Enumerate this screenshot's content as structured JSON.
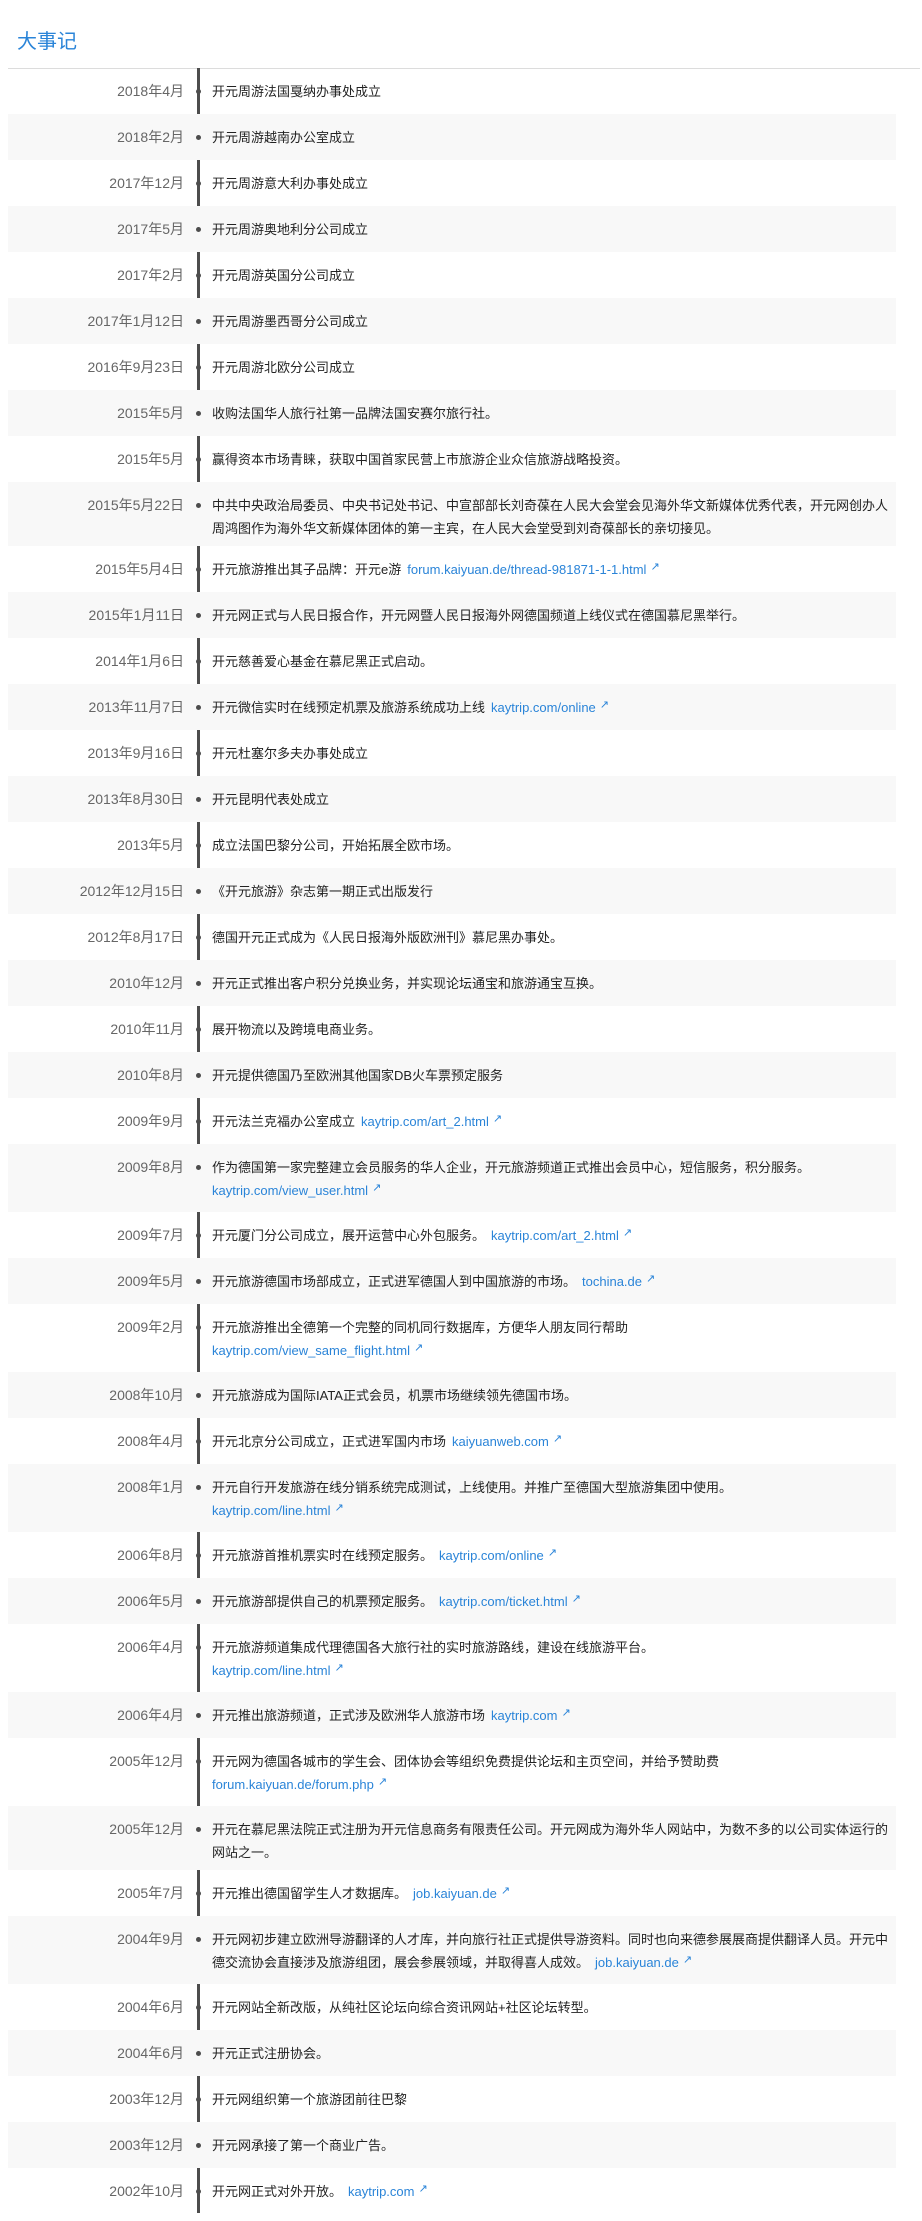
{
  "header": {
    "title": "大事记"
  },
  "events": [
    {
      "date": "2018年4月",
      "text": "开元周游法国戛纳办事处成立"
    },
    {
      "date": "2018年2月",
      "text": "开元周游越南办公室成立"
    },
    {
      "date": "2017年12月",
      "text": "开元周游意大利办事处成立"
    },
    {
      "date": "2017年5月",
      "text": "开元周游奥地利分公司成立"
    },
    {
      "date": "2017年2月",
      "text": "开元周游英国分公司成立"
    },
    {
      "date": "2017年1月12日",
      "text": "开元周游墨西哥分公司成立"
    },
    {
      "date": "2016年9月23日",
      "text": "开元周游北欧分公司成立"
    },
    {
      "date": "2015年5月",
      "text": "收购法国华人旅行社第一品牌法国安赛尔旅行社。"
    },
    {
      "date": "2015年5月",
      "text": "赢得资本市场青睐，获取中国首家民营上市旅游企业众信旅游战略投资。"
    },
    {
      "date": "2015年5月22日",
      "text": "中共中央政治局委员、中央书记处书记、中宣部部长刘奇葆在人民大会堂会见海外华文新媒体优秀代表，开元网创办人周鸿图作为海外华文新媒体团体的第一主宾，在人民大会堂受到刘奇葆部长的亲切接见。"
    },
    {
      "date": "2015年5月4日",
      "text": "开元旅游推出其子品牌：开元e游",
      "link": "forum.kaiyuan.de/thread-981871-1-1.html"
    },
    {
      "date": "2015年1月11日",
      "text": "开元网正式与人民日报合作，开元网暨人民日报海外网德国频道上线仪式在德国慕尼黑举行。"
    },
    {
      "date": "2014年1月6日",
      "text": "开元慈善爱心基金在慕尼黑正式启动。"
    },
    {
      "date": "2013年11月7日",
      "text": "开元微信实时在线预定机票及旅游系统成功上线",
      "link": "kaytrip.com/online"
    },
    {
      "date": "2013年9月16日",
      "text": "开元杜塞尔多夫办事处成立"
    },
    {
      "date": "2013年8月30日",
      "text": "开元昆明代表处成立"
    },
    {
      "date": "2013年5月",
      "text": "成立法国巴黎分公司，开始拓展全欧市场。"
    },
    {
      "date": "2012年12月15日",
      "text": "《开元旅游》杂志第一期正式出版发行"
    },
    {
      "date": "2012年8月17日",
      "text": "德国开元正式成为《人民日报海外版欧洲刊》慕尼黑办事处。"
    },
    {
      "date": "2010年12月",
      "text": "开元正式推出客户积分兑换业务，并实现论坛通宝和旅游通宝互换。"
    },
    {
      "date": "2010年11月",
      "text": "展开物流以及跨境电商业务。"
    },
    {
      "date": "2010年8月",
      "text": "开元提供德国乃至欧洲其他国家DB火车票预定服务"
    },
    {
      "date": "2009年9月",
      "text": "开元法兰克福办公室成立",
      "link": "kaytrip.com/art_2.html"
    },
    {
      "date": "2009年8月",
      "text": "作为德国第一家完整建立会员服务的华人企业，开元旅游频道正式推出会员中心，短信服务，积分服务。",
      "link": "kaytrip.com/view_user.html"
    },
    {
      "date": "2009年7月",
      "text": "开元厦门分公司成立，展开运营中心外包服务。",
      "link": "kaytrip.com/art_2.html"
    },
    {
      "date": "2009年5月",
      "text": "开元旅游德国市场部成立，正式进军德国人到中国旅游的市场。",
      "link": "tochina.de"
    },
    {
      "date": "2009年2月",
      "text": "开元旅游推出全德第一个完整的同机同行数据库，方便华人朋友同行帮助",
      "link": "kaytrip.com/view_same_flight.html"
    },
    {
      "date": "2008年10月",
      "text": "开元旅游成为国际IATA正式会员，机票市场继续领先德国市场。"
    },
    {
      "date": "2008年4月",
      "text": "开元北京分公司成立，正式进军国内市场",
      "link": "kaiyuanweb.com"
    },
    {
      "date": "2008年1月",
      "text": "开元自行开发旅游在线分销系统完成测试，上线使用。并推广至德国大型旅游集团中使用。",
      "link": "kaytrip.com/line.html"
    },
    {
      "date": "2006年8月",
      "text": "开元旅游首推机票实时在线预定服务。",
      "link": "kaytrip.com/online"
    },
    {
      "date": "2006年5月",
      "text": "开元旅游部提供自己的机票预定服务。",
      "link": "kaytrip.com/ticket.html"
    },
    {
      "date": "2006年4月",
      "text": "开元旅游频道集成代理德国各大旅行社的实时旅游路线，建设在线旅游平台。",
      "link": "kaytrip.com/line.html"
    },
    {
      "date": "2006年4月",
      "text": "开元推出旅游频道，正式涉及欧洲华人旅游市场",
      "link": "kaytrip.com"
    },
    {
      "date": "2005年12月",
      "text": "开元网为德国各城市的学生会、团体协会等组织免费提供论坛和主页空间，并给予赞助费",
      "link": "forum.kaiyuan.de/forum.php"
    },
    {
      "date": "2005年12月",
      "text": "开元在慕尼黑法院正式注册为开元信息商务有限责任公司。开元网成为海外华人网站中，为数不多的以公司实体运行的网站之一。"
    },
    {
      "date": "2005年7月",
      "text": "开元推出德国留学生人才数据库。",
      "link": "job.kaiyuan.de"
    },
    {
      "date": "2004年9月",
      "text": "开元网初步建立欧洲导游翻译的人才库，并向旅行社正式提供导游资料。同时也向来德参展展商提供翻译人员。开元中德交流协会直接涉及旅游组团，展会参展领域，并取得喜人成效。",
      "link": "job.kaiyuan.de"
    },
    {
      "date": "2004年6月",
      "text": "开元网站全新改版，从纯社区论坛向综合资讯网站+社区论坛转型。"
    },
    {
      "date": "2004年6月",
      "text": "开元正式注册协会。"
    },
    {
      "date": "2003年12月",
      "text": "开元网组织第一个旅游团前往巴黎"
    },
    {
      "date": "2003年12月",
      "text": "开元网承接了第一个商业广告。"
    },
    {
      "date": "2002年10月",
      "text": "开元网正式对外开放。",
      "link": "kaytrip.com"
    }
  ]
}
